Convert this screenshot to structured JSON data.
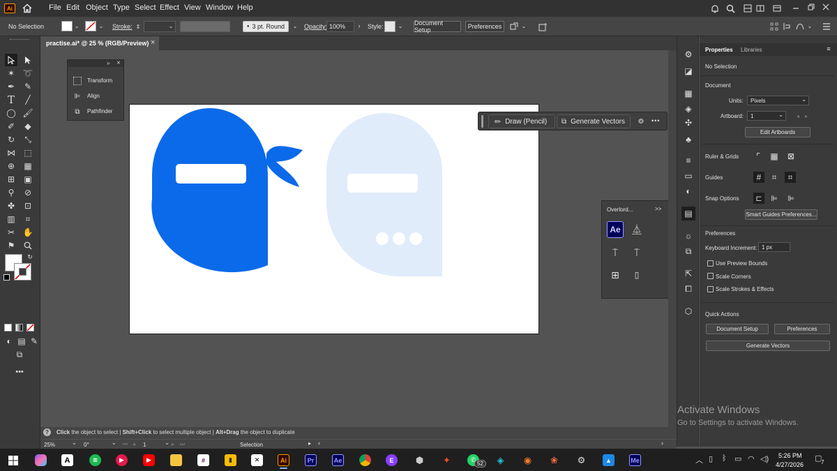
{
  "app": {
    "logo": "Ai"
  },
  "menu": [
    "File",
    "Edit",
    "Object",
    "Type",
    "Select",
    "Effect",
    "View",
    "Window",
    "Help"
  ],
  "control": {
    "selection_label": "No Selection",
    "stroke_label": "Stroke:",
    "brush_label": "3 pt. Round",
    "opacity_label": "Opacity:",
    "opacity_value": "100%",
    "style_label": "Style:",
    "document_setup": "Document Setup",
    "preferences": "Preferences"
  },
  "document_tab": {
    "title": "practise.ai* @ 25 % (RGB/Preview)",
    "close": "×"
  },
  "float_panel": {
    "items": [
      "Transform",
      "Align",
      "Pathfinder"
    ],
    "expand": "»",
    "close": "×"
  },
  "context_bar": {
    "draw": "Draw (Pencil)",
    "generate": "Generate Vectors",
    "more": "•••"
  },
  "overlord_panel": {
    "title": "Overlord...",
    "expand": ">>",
    "ae_label": "Ae"
  },
  "properties": {
    "tab_properties": "Properties",
    "tab_libraries": "Libraries",
    "selection": "No Selection",
    "document": "Document",
    "units_label": "Units:",
    "units_value": "Pixels",
    "artboard_label": "Artboard:",
    "artboard_value": "1",
    "edit_artboards": "Edit Artboards",
    "ruler_grids": "Ruler & Grids",
    "guides": "Guides",
    "snap_options": "Snap Options",
    "smart_guides": "Smart Guides Preferences...",
    "preferences_section": "Preferences",
    "keyboard_increment_label": "Keyboard Increment:",
    "keyboard_increment_value": "1 px",
    "use_preview_bounds": "Use Preview Bounds",
    "scale_corners": "Scale Corners",
    "scale_strokes": "Scale Strokes & Effects",
    "quick_actions": "Quick Actions",
    "qa_document_setup": "Document Setup",
    "qa_preferences": "Preferences",
    "qa_generate_vectors": "Generate Vectors"
  },
  "status": {
    "h1": "Click",
    "t1": " the object to select  |  ",
    "h2": "Shift+Click",
    "t2": " to select multiple object  |  ",
    "h3": "Alt+Drag",
    "t3": " the object to duplicate"
  },
  "bottom": {
    "zoom": "25%",
    "rotation": "0°",
    "artboard": "1",
    "tool": "Selection"
  },
  "watermark": {
    "title": "Activate Windows",
    "subtitle": "Go to Settings to activate Windows."
  },
  "taskbar": {
    "time": "5:26 PM",
    "date": "4/27/2026",
    "whatsapp_badge": "52",
    "notif_count": "7",
    "apps": [
      "Ai",
      "Pr",
      "Ae",
      "Me"
    ]
  },
  "colors": {
    "artwork_blue": "#0b6ae9",
    "artwork_light": "#e0ecfa",
    "ai_orange": "#ff9a00",
    "ai_bg": "#330000"
  }
}
